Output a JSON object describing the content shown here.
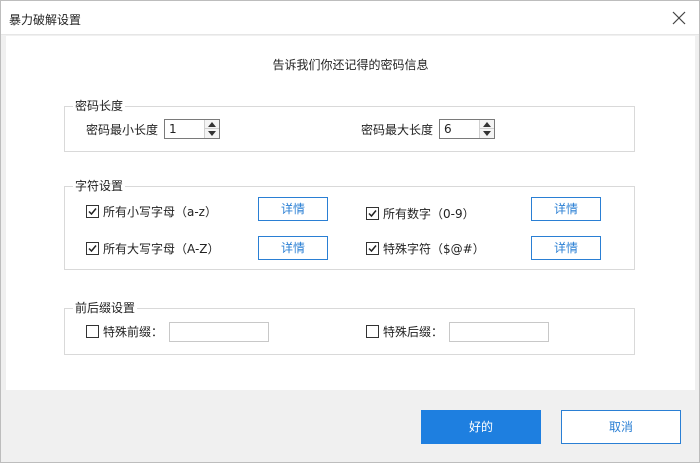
{
  "window": {
    "title": "暴力破解设置"
  },
  "subtitle": "告诉我们你还记得的密码信息",
  "length_group": {
    "label": "密码长度",
    "min_label": "密码最小长度",
    "min_value": "1",
    "max_label": "密码最大长度",
    "max_value": "6"
  },
  "charset_group": {
    "label": "字符设置",
    "options": [
      {
        "label": "所有小写字母（a-z）",
        "checked": true,
        "detail": "详情"
      },
      {
        "label": "所有数字（0-9）",
        "checked": true,
        "detail": "详情"
      },
      {
        "label": "所有大写字母（A-Z）",
        "checked": true,
        "detail": "详情"
      },
      {
        "label": "特殊字符（$@#）",
        "checked": true,
        "detail": "详情"
      }
    ]
  },
  "affix_group": {
    "label": "前后缀设置",
    "prefix_label": "特殊前缀：",
    "prefix_checked": false,
    "prefix_value": "",
    "suffix_label": "特殊后缀：",
    "suffix_checked": false,
    "suffix_value": ""
  },
  "footer": {
    "ok_label": "好的",
    "cancel_label": "取消"
  },
  "colors": {
    "accent": "#1e7fe0",
    "border": "#d9d9d9",
    "background": "#f0f0f0"
  },
  "icons": {
    "close": "close-icon",
    "check": "check-icon",
    "spin_up": "arrow-up-icon",
    "spin_down": "arrow-down-icon"
  }
}
